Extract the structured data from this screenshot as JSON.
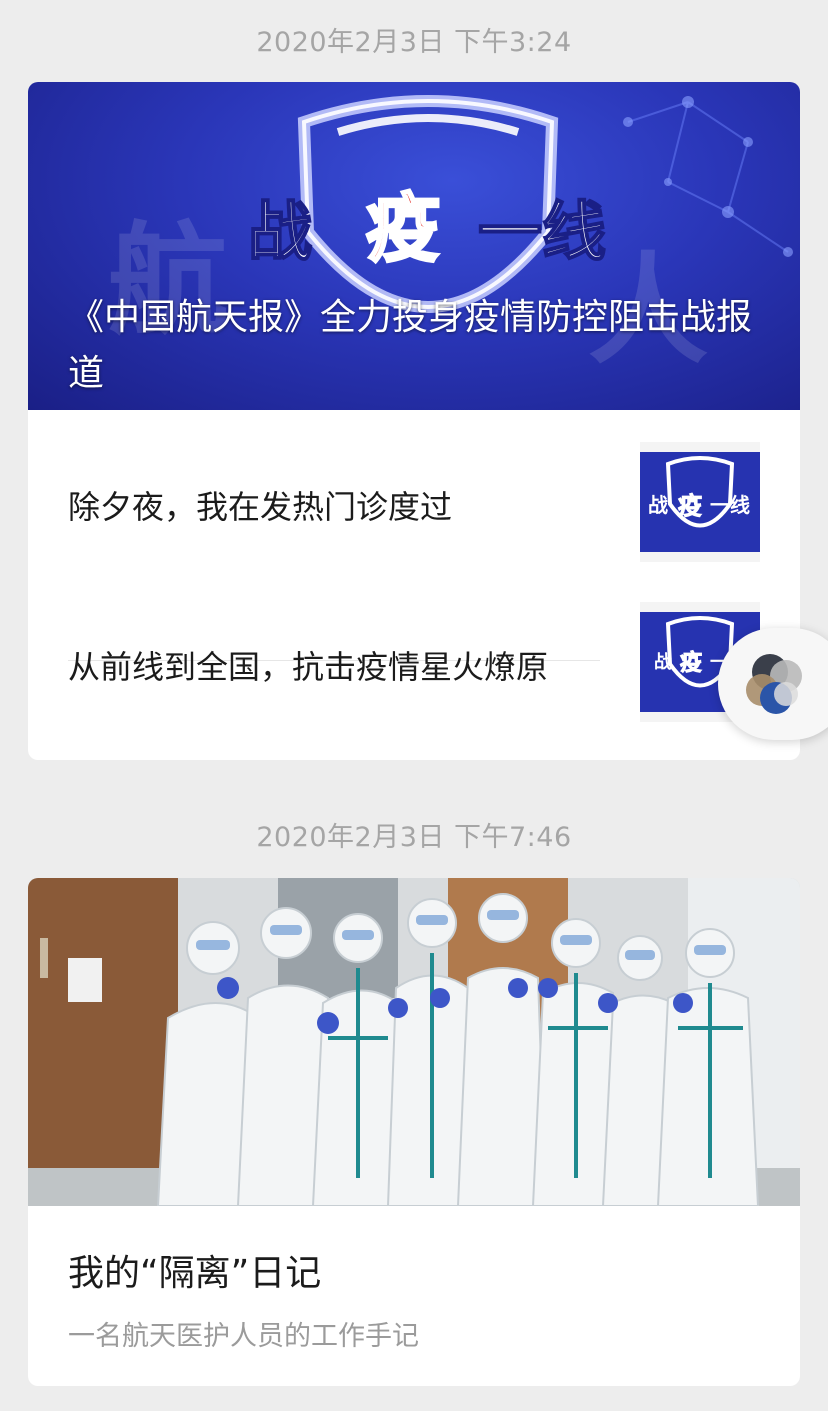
{
  "feed": [
    {
      "timestamp": "2020年2月3日 下午3:24",
      "hero": {
        "banner_text_parts": [
          "战",
          "疫",
          "一线"
        ],
        "title": "《中国航天报》全力投身疫情防控阻击战报道"
      },
      "items": [
        {
          "title": "除夕夜，我在发热门诊度过",
          "thumb_text_parts": [
            "战",
            "疫",
            "一线"
          ]
        },
        {
          "title": "从前线到全国，抗击疫情星火燎原",
          "thumb_text_parts": [
            "战",
            "疫",
            "一"
          ]
        }
      ]
    },
    {
      "timestamp": "2020年2月3日 下午7:46",
      "cover": {
        "description_icon": "medical-team-photo"
      },
      "title": "我的“隔离”日记",
      "subtitle": "一名航天医护人员的工作手记"
    }
  ],
  "floating_button": {
    "icon": "multi-circle-assistant-icon"
  },
  "colors": {
    "background": "#ededed",
    "card": "#ffffff",
    "timestamp": "#a5a5a5",
    "banner_blue": "#2633b0",
    "banner_red": "#e0241c"
  }
}
